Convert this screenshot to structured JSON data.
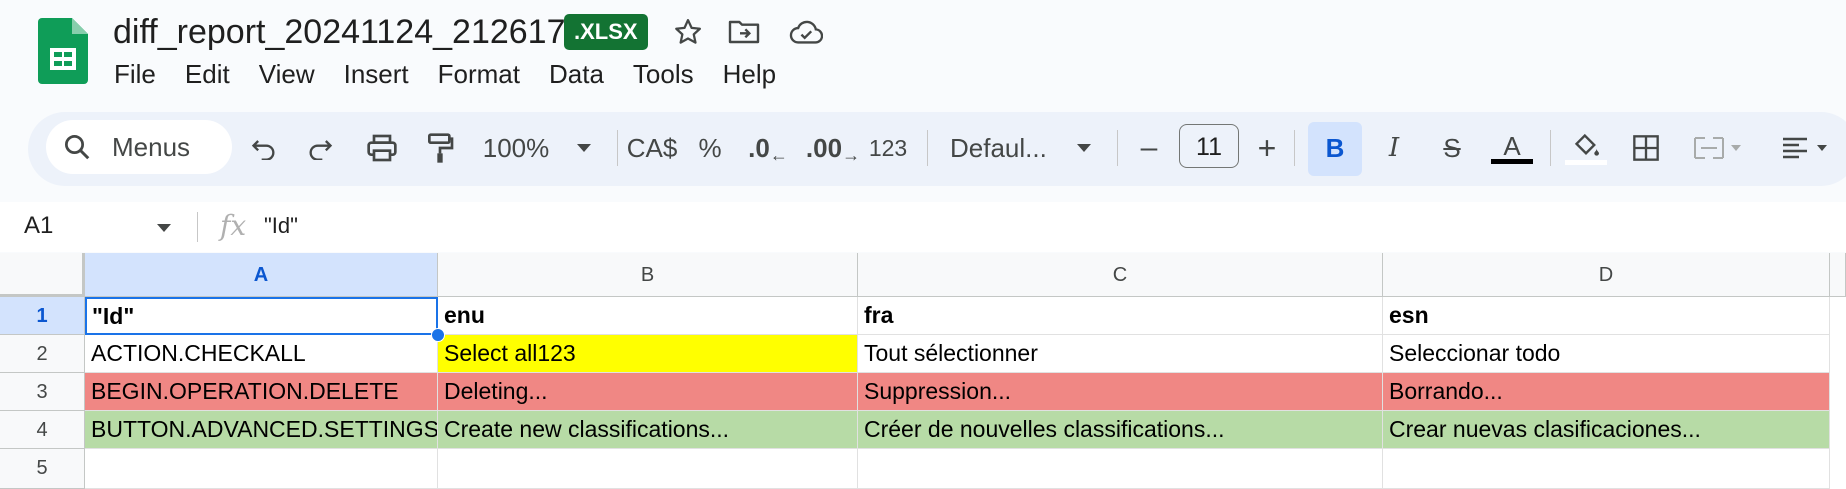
{
  "document": {
    "title": "diff_report_20241124_212617",
    "format_badge": ".XLSX"
  },
  "menu": [
    "File",
    "Edit",
    "View",
    "Insert",
    "Format",
    "Data",
    "Tools",
    "Help"
  ],
  "toolbar": {
    "search_label": "Menus",
    "zoom": "100%",
    "currency": "CA$",
    "percent": "%",
    "decrease_decimal": ".0",
    "increase_decimal": ".00",
    "number_format": "123",
    "font_family": "Defaul...",
    "font_size": "11",
    "minus": "–",
    "plus": "+"
  },
  "formula_bar": {
    "cell_ref": "A1",
    "fx": "fx",
    "value": "\"Id\""
  },
  "sheet": {
    "columns": [
      "A",
      "B",
      "C",
      "D"
    ],
    "rows": [
      "1",
      "2",
      "3",
      "4",
      "5"
    ],
    "cells": [
      [
        "\"Id\"",
        "enu",
        "fra",
        "esn"
      ],
      [
        "ACTION.CHECKALL",
        "Select all123",
        "Tout sélectionner",
        "Seleccionar todo"
      ],
      [
        "BEGIN.OPERATION.DELETE",
        "Deleting...",
        "Suppression...",
        "Borrando..."
      ],
      [
        "BUTTON.ADVANCED.SETTINGS",
        "Create new classifications...",
        "Créer de nouvelles classifications...",
        "Crear nuevas clasificaciones..."
      ],
      [
        "",
        "",
        "",
        ""
      ]
    ]
  },
  "colors": {
    "highlight_yellow": "#ffff00",
    "row_red": "#f08784",
    "row_green": "#b7dba6",
    "selection_blue": "#1a73e8",
    "sheets_green": "#0f9d58"
  }
}
